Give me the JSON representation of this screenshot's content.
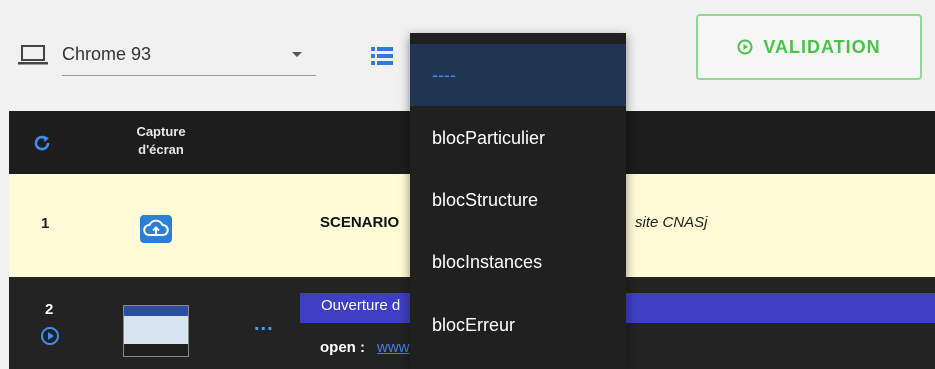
{
  "toolbar": {
    "browser_select": {
      "value": "Chrome 93",
      "icon": "laptop-icon"
    },
    "view_icon": "list-icon",
    "validation_label": "VALIDATION",
    "validation_color": "#4cc24c"
  },
  "table": {
    "header": {
      "refresh_icon": "refresh-icon",
      "capture_label_line1": "Capture",
      "capture_label_line2": "d'écran"
    },
    "rows": [
      {
        "number": "1",
        "capture_icon": "cloud-upload-icon",
        "label": "SCENARIO",
        "description": "site CNASj"
      },
      {
        "number": "2",
        "action_icon": "play-circle-icon",
        "more": "...",
        "step_label": "Ouverture d",
        "command": "open :",
        "link_text": "www"
      }
    ]
  },
  "dropdown": {
    "selected": "----",
    "items": [
      "----",
      "blocParticulier",
      "blocStructure",
      "blocInstances",
      "blocErreur"
    ]
  },
  "colors": {
    "accent": "#3d8ef2",
    "header_bg": "#1d1d1d",
    "row_highlight": "#fffbd6",
    "step_bar": "#3f3fc4"
  }
}
